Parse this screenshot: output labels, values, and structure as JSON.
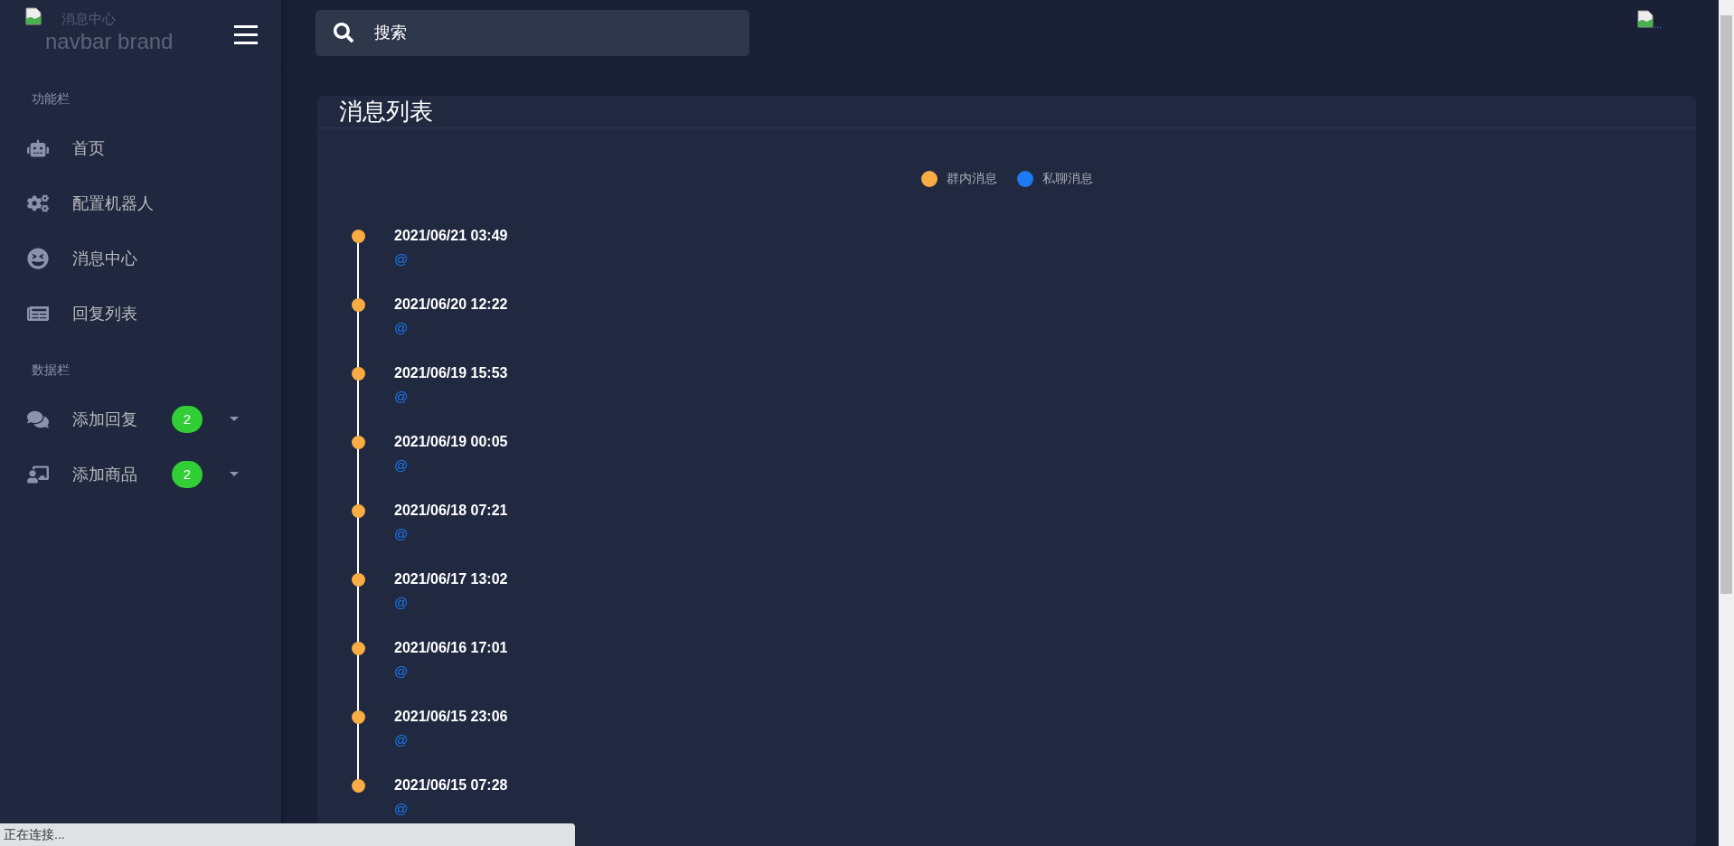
{
  "brand": {
    "title": "消息中心",
    "alt": "navbar brand"
  },
  "search": {
    "placeholder": "搜索"
  },
  "avatar": {
    "alt": "..."
  },
  "sidebar": {
    "sections": [
      {
        "heading": "功能栏",
        "items": [
          {
            "label": "首页"
          },
          {
            "label": "配置机器人"
          },
          {
            "label": "消息中心"
          },
          {
            "label": "回复列表"
          }
        ]
      },
      {
        "heading": "数据栏",
        "items": [
          {
            "label": "添加回复",
            "badge": "2",
            "expanded": false
          },
          {
            "label": "添加商品",
            "badge": "2",
            "expanded": false
          }
        ]
      }
    ]
  },
  "card": {
    "title": "消息列表",
    "legend": [
      {
        "label": "群内消息",
        "color": "#f9ab44"
      },
      {
        "label": "私聊消息",
        "color": "#1d7af3"
      }
    ],
    "timeline": [
      {
        "time": "2021/06/21 03:49",
        "text": "@",
        "color": "#f9ab44"
      },
      {
        "time": "2021/06/20 12:22",
        "text": "@",
        "color": "#f9ab44"
      },
      {
        "time": "2021/06/19 15:53",
        "text": "@",
        "color": "#f9ab44"
      },
      {
        "time": "2021/06/19 00:05",
        "text": "@",
        "color": "#f9ab44"
      },
      {
        "time": "2021/06/18 07:21",
        "text": "@",
        "color": "#f9ab44"
      },
      {
        "time": "2021/06/17 13:02",
        "text": "@",
        "color": "#f9ab44"
      },
      {
        "time": "2021/06/16 17:01",
        "text": "@",
        "color": "#f9ab44"
      },
      {
        "time": "2021/06/15 23:06",
        "text": "@",
        "color": "#f9ab44"
      },
      {
        "time": "2021/06/15 07:28",
        "text": "@",
        "color": "#f9ab44"
      }
    ]
  },
  "status_bar": {
    "text": "正在连接..."
  }
}
